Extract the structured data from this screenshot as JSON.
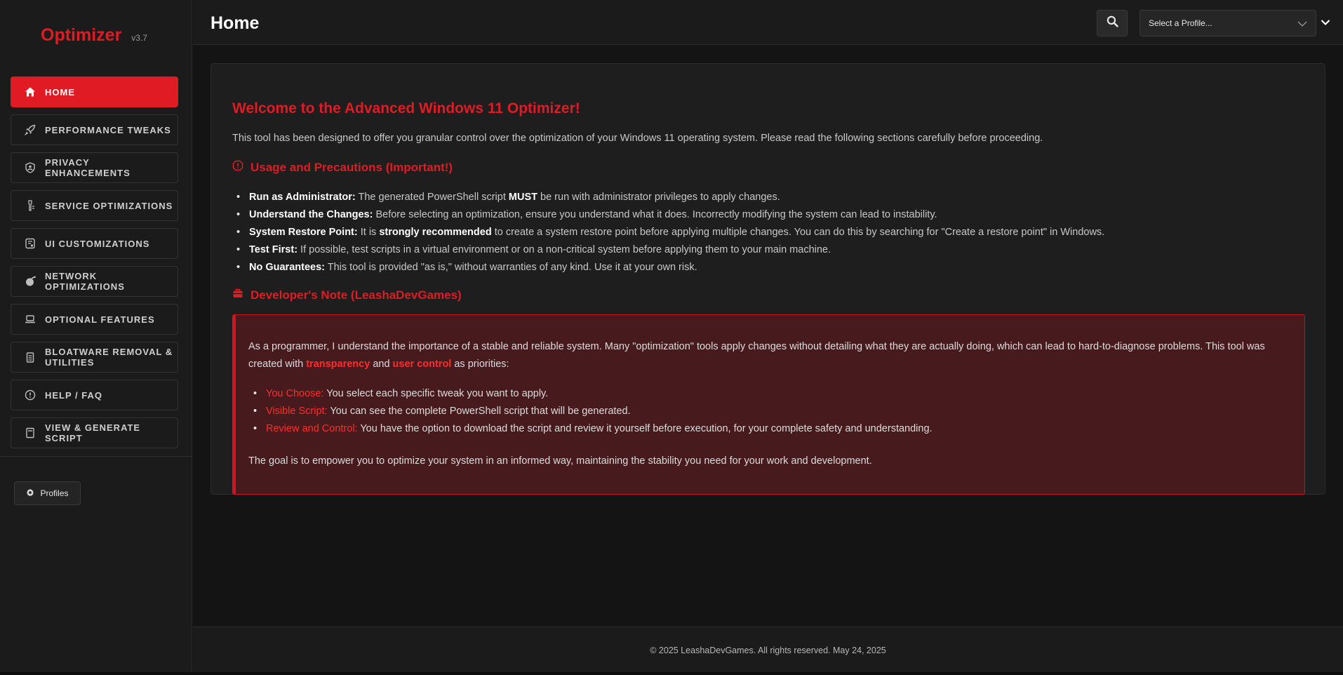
{
  "brand": {
    "name": "Optimizer",
    "version": "v3.7"
  },
  "colors": {
    "accent": "#e01b24",
    "background": "#141414",
    "panel": "#1e1e1e",
    "note_bg": "#471a1e"
  },
  "nav": [
    {
      "label": "HOME",
      "icon": "home-icon",
      "active": true
    },
    {
      "label": "PERFORMANCE TWEAKS",
      "icon": "rocket-icon"
    },
    {
      "label": "PRIVACY ENHANCEMENTS",
      "icon": "shield-user-icon"
    },
    {
      "label": "SERVICE OPTIMIZATIONS",
      "icon": "service-tools-icon"
    },
    {
      "label": "UI CUSTOMIZATIONS",
      "icon": "palette-icon"
    },
    {
      "label": "NETWORK OPTIMIZATIONS",
      "icon": "network-icon"
    },
    {
      "label": "OPTIONAL FEATURES",
      "icon": "laptop-icon"
    },
    {
      "label": "BLOATWARE REMOVAL & UTILITIES",
      "icon": "trash-icon"
    },
    {
      "label": "HELP / FAQ",
      "icon": "help-icon"
    },
    {
      "label": "VIEW & GENERATE SCRIPT",
      "icon": "script-icon"
    }
  ],
  "profiles_button": {
    "label": "Profiles",
    "icon": "gear-icon"
  },
  "header": {
    "title": "Home",
    "search_icon": "search-icon",
    "profile_select": {
      "selected": "Select a Profile..."
    }
  },
  "main": {
    "welcome_title": "Welcome to the Advanced Windows 11 Optimizer!",
    "intro": "This tool has been designed to offer you granular control over the optimization of your Windows 11 operating system. Please read the following sections carefully before proceeding.",
    "usage_title": "Usage and Precautions (Important!)",
    "usage": {
      "admin_label": "Run as Administrator:",
      "admin_text_a": " The generated PowerShell script ",
      "admin_must": "MUST",
      "admin_text_b": " be run with administrator privileges to apply changes.",
      "understand_label": "Understand the Changes:",
      "understand_text": " Before selecting an optimization, ensure you understand what it does. Incorrectly modifying the system can lead to instability.",
      "restore_label": "System Restore Point:",
      "restore_text_a": " It is ",
      "restore_strong": "strongly recommended",
      "restore_text_b": " to create a system restore point before applying multiple changes. You can do this by searching for \"Create a restore point\" in Windows.",
      "test_label": "Test First:",
      "test_text": " If possible, test scripts in a virtual environment or on a non-critical system before applying them to your main machine.",
      "guarantee_label": "No Guarantees:",
      "guarantee_text": " This tool is provided \"as is,\" without warranties of any kind. Use it at your own risk."
    },
    "dev_title": "Developer's Note (LeashaDevGames)",
    "dev_note": {
      "para_a": "As a programmer, I understand the importance of a stable and reliable system. Many \"optimization\" tools apply changes without detailing what they are actually doing, which can lead to hard-to-diagnose problems. This tool was created with ",
      "transparency": "transparency",
      "and": " and ",
      "user_control": "user control",
      "para_b": " as priorities:",
      "choose_label": "You Choose:",
      "choose_text": " You select each specific tweak you want to apply.",
      "visible_label": "Visible Script:",
      "visible_text": " You can see the complete PowerShell script that will be generated.",
      "review_label": "Review and Control:",
      "review_text": " You have the option to download the script and review it yourself before execution, for your complete safety and understanding.",
      "goal": "The goal is to empower you to optimize your system in an informed way, maintaining the stability you need for your work and development."
    }
  },
  "footer": {
    "text": "© 2025 LeashaDevGames. All rights reserved. May 24, 2025"
  }
}
